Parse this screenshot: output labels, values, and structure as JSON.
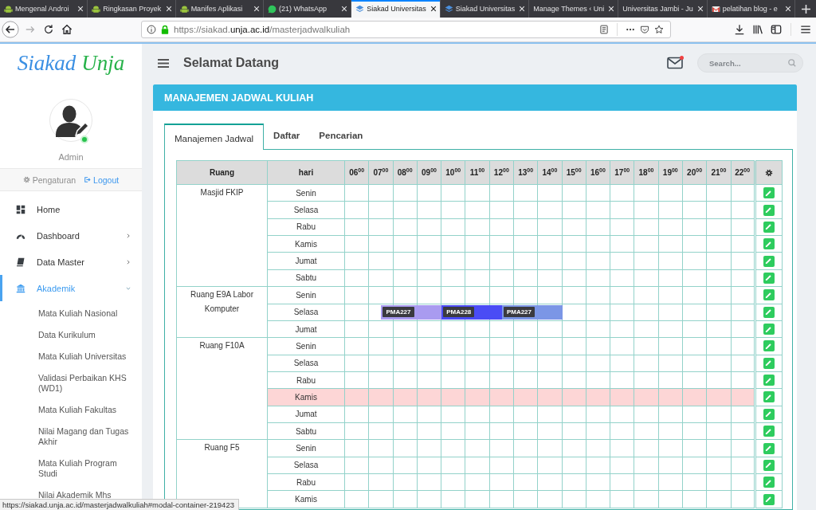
{
  "browser": {
    "tabs": [
      {
        "title": "Mengenal Androi",
        "selected": false
      },
      {
        "title": "Ringkasan Proyek",
        "selected": false
      },
      {
        "title": "Manifes Aplikasi",
        "selected": false
      },
      {
        "title": "(21) WhatsApp",
        "selected": false
      },
      {
        "title": "Siakad Universitas",
        "selected": true
      },
      {
        "title": "Siakad Universitas",
        "selected": false
      },
      {
        "title": "Manage Themes ‹ Uni",
        "selected": false
      },
      {
        "title": "Universitas Jambi - Ju",
        "selected": false
      },
      {
        "title": "pelatihan blog - e",
        "selected": false
      }
    ],
    "url": {
      "scheme": "https://siakad.",
      "domain": "unja.ac.id",
      "path": "/masterjadwalkuliah"
    }
  },
  "sidebar": {
    "logo": [
      "Siakad",
      "Unja"
    ],
    "user": {
      "name": "Admin",
      "online": true
    },
    "links": [
      {
        "label": "Pengaturan"
      },
      {
        "label": "Logout"
      }
    ],
    "menu": [
      {
        "label": "Home",
        "expandable": false,
        "selected": false
      },
      {
        "label": "Dashboard",
        "expandable": true,
        "expanded": false,
        "selected": false
      },
      {
        "label": "Data Master",
        "expandable": true,
        "expanded": false,
        "selected": false
      },
      {
        "label": "Akademik",
        "expandable": true,
        "expanded": true,
        "selected": true,
        "children": [
          {
            "label": "Mata Kuliah Nasional"
          },
          {
            "label": "Data Kurikulum"
          },
          {
            "label": "Mata Kuliah Universitas"
          },
          {
            "label": "Validasi Perbaikan KHS (WD1)"
          },
          {
            "label": "Mata Kuliah Fakultas"
          },
          {
            "label": "Nilai Magang dan Tugas Akhir"
          },
          {
            "label": "Mata Kuliah Program Studi"
          },
          {
            "label": "Nilai Akademik Mhs"
          }
        ]
      }
    ]
  },
  "header": {
    "title": "Selamat Datang",
    "unread_mail": true,
    "search": {
      "placeholder": "Search..."
    }
  },
  "panel": {
    "title": "MANAJEMEN JADWAL KULIAH",
    "tabs": [
      {
        "label": "Manajemen Jadwal",
        "selected": true
      },
      {
        "label": "Daftar",
        "selected": false
      },
      {
        "label": "Pencarian",
        "selected": false
      }
    ],
    "table": {
      "columns": {
        "room": "Ruang",
        "day": "hari",
        "hours": [
          "06$^{00}$",
          "07$^{00}$",
          "08$^{00}$",
          "09$^{00}$",
          "10$^{00}$",
          "11$^{00}$",
          "12$^{00}$",
          "13$^{00}$",
          "14$^{00}$",
          "15$^{00}$",
          "16$^{00}$",
          "17$^{00}$",
          "18$^{00}$",
          "19$^{00}$",
          "20$^{00}$",
          "21$^{00}$",
          "22$^{00}$"
        ]
      },
      "rooms": [
        {
          "name": "Masjid FKIP",
          "days": [
            {
              "day": "Senin",
              "highlighted": false
            },
            {
              "day": "Selasa",
              "highlighted": false
            },
            {
              "day": "Rabu",
              "highlighted": false
            },
            {
              "day": "Kamis",
              "highlighted": false
            },
            {
              "day": "Jumat",
              "highlighted": false
            },
            {
              "day": "Sabtu",
              "highlighted": false
            }
          ]
        },
        {
          "name": "Ruang E9A Labor Komputer",
          "days": [
            {
              "day": "Senin",
              "highlighted": false
            },
            {
              "day": "Selasa",
              "highlighted": false,
              "sessions": [
                {
                  "code": "PMA227",
                  "color": "#a99bf0"
                },
                {
                  "code": "PMA228",
                  "color": "#4a4cf5"
                },
                {
                  "code": "PMA227",
                  "color": "#7b96e6"
                }
              ]
            },
            {
              "day": "Jumat",
              "highlighted": false
            }
          ]
        },
        {
          "name": "Ruang F10A",
          "days": [
            {
              "day": "Senin",
              "highlighted": false
            },
            {
              "day": "Selasa",
              "highlighted": false
            },
            {
              "day": "Rabu",
              "highlighted": false
            },
            {
              "day": "Kamis",
              "highlighted": true
            },
            {
              "day": "Jumat",
              "highlighted": false
            },
            {
              "day": "Sabtu",
              "highlighted": false
            }
          ]
        },
        {
          "name": "Ruang F5",
          "days": [
            {
              "day": "Senin",
              "highlighted": false
            },
            {
              "day": "Selasa",
              "highlighted": false
            },
            {
              "day": "Rabu",
              "highlighted": false
            },
            {
              "day": "Kamis",
              "highlighted": false
            }
          ]
        }
      ]
    }
  },
  "status_bar": "https://siakad.unja.ac.id/masterjadwalkuliah#modal-container-219423"
}
